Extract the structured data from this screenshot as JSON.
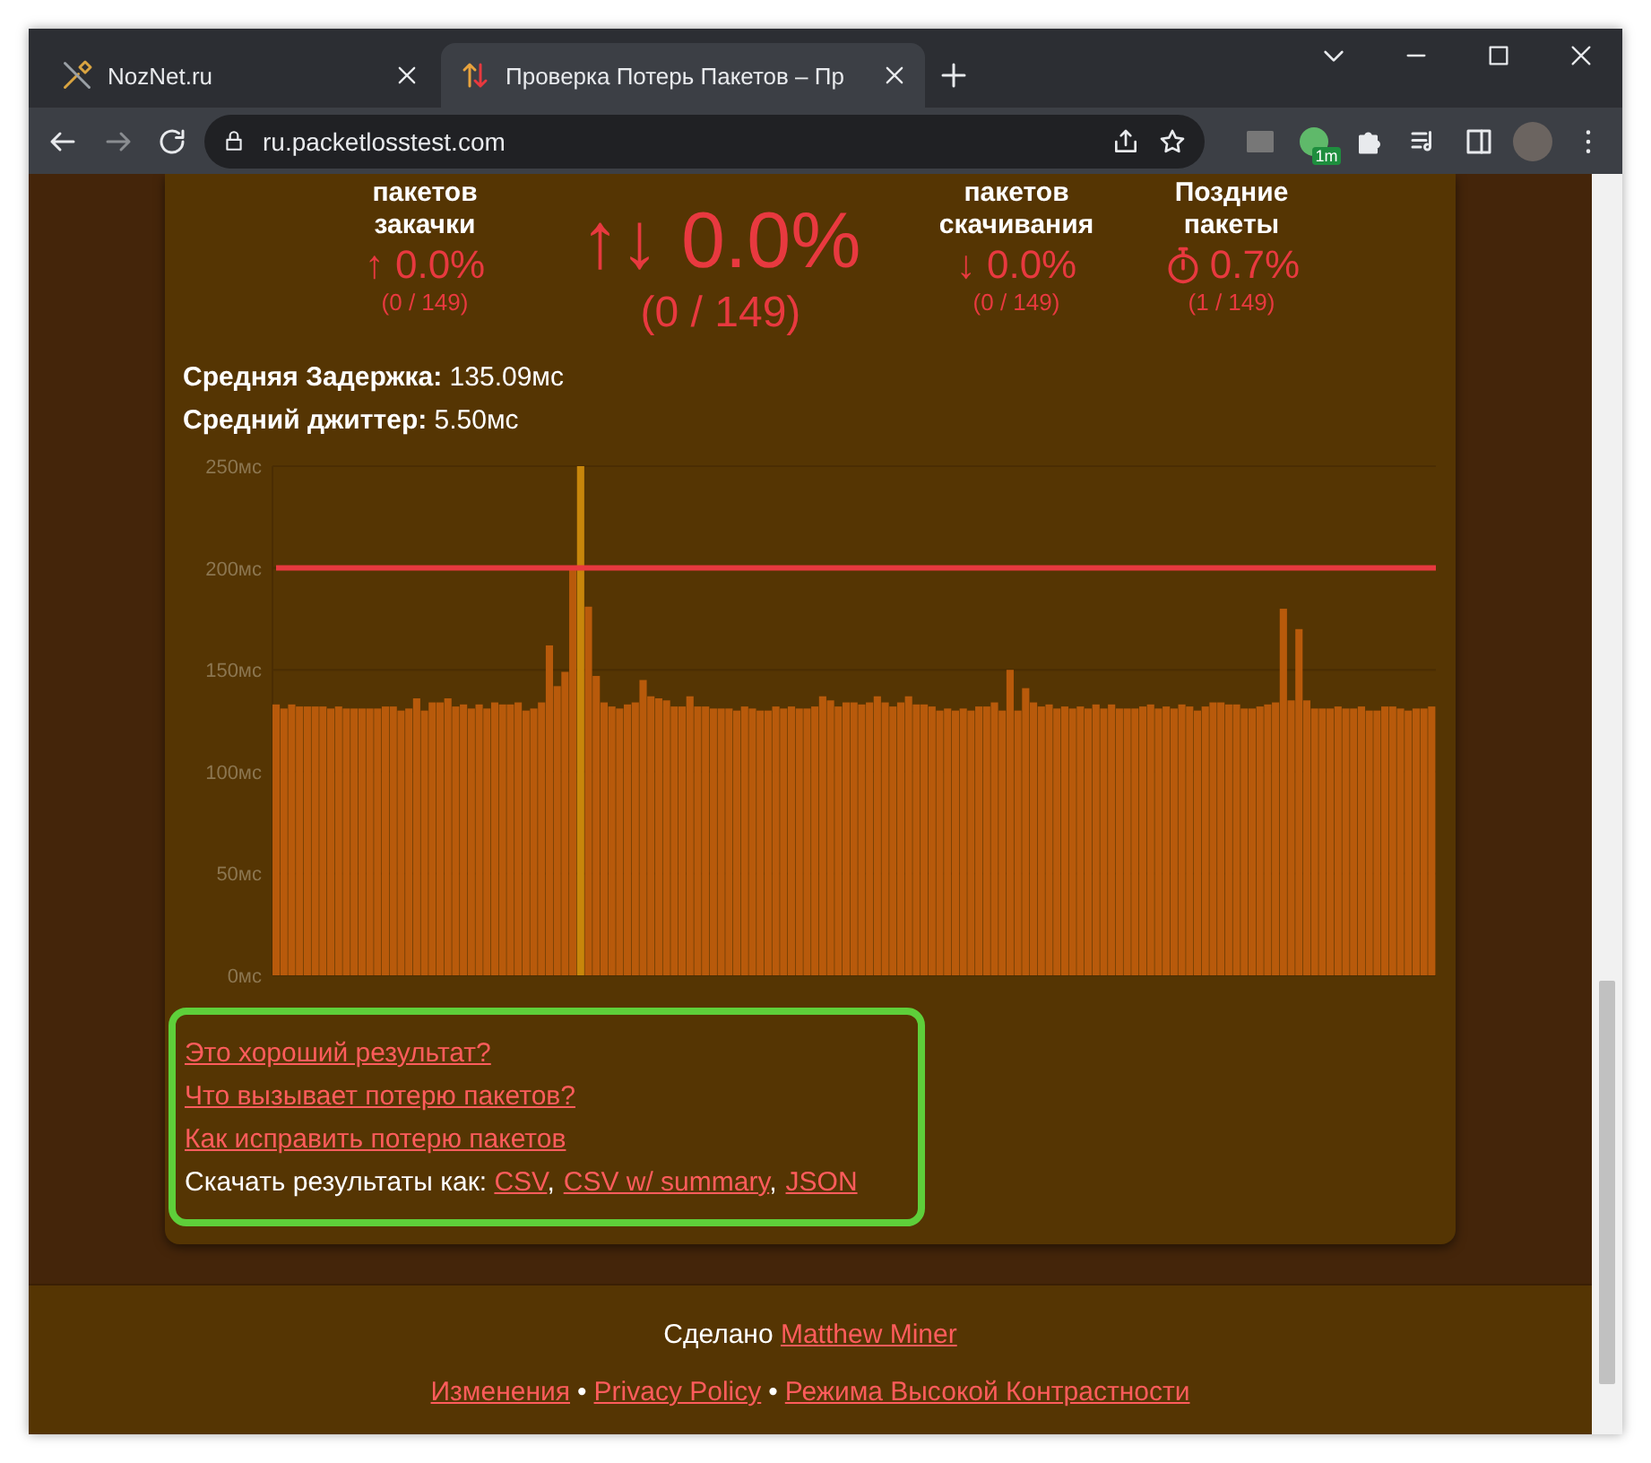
{
  "browser": {
    "tabs": [
      {
        "title": "NozNet.ru",
        "selected": false
      },
      {
        "title": "Проверка Потерь Пакетов – Пр",
        "selected": true
      }
    ],
    "url": "ru.packetlosstest.com",
    "extension_badge": "1m"
  },
  "stats": [
    {
      "kind": "side",
      "label": [
        "пакетов",
        "закачки"
      ],
      "value": "↑ 0.0%",
      "count": "(0 / 149)"
    },
    {
      "kind": "main",
      "value": "↑↓ 0.0%",
      "count": "(0 / 149)"
    },
    {
      "kind": "side",
      "label": [
        "пакетов",
        "скачивания"
      ],
      "value": "↓ 0.0%",
      "count": "(0 / 149)"
    },
    {
      "kind": "timer",
      "label": [
        "Поздние",
        "пакеты"
      ],
      "value": "0.7%",
      "count": "(1 / 149)"
    }
  ],
  "latency": [
    "**Средняя Задержка:** 135.09мс",
    "**Средний джиттер:** 5.50мс"
  ],
  "chart_data": {
    "type": "bar",
    "ylim": [
      0,
      250
    ],
    "yticks": [
      {
        "value": 0,
        "label": "0мс"
      },
      {
        "value": 50,
        "label": "50мс"
      },
      {
        "value": 100,
        "label": "100мс"
      },
      {
        "value": 150,
        "label": "150мс"
      },
      {
        "value": 200,
        "label": "200мс"
      },
      {
        "value": 250,
        "label": "250мс"
      }
    ],
    "values": [
      133,
      131,
      133,
      132,
      132,
      132,
      132,
      131,
      132,
      131,
      131,
      131,
      131,
      131,
      132,
      132,
      130,
      131,
      136,
      130,
      134,
      134,
      136,
      132,
      133,
      131,
      133,
      131,
      134,
      133,
      133,
      134,
      130,
      131,
      134,
      162,
      142,
      149,
      200,
      250,
      181,
      147,
      134,
      132,
      131,
      133,
      134,
      145,
      137,
      136,
      135,
      132,
      132,
      137,
      132,
      132,
      131,
      131,
      131,
      130,
      132,
      131,
      130,
      130,
      132,
      131,
      132,
      131,
      131,
      132,
      137,
      135,
      132,
      134,
      134,
      133,
      134,
      137,
      134,
      132,
      134,
      137,
      133,
      133,
      132,
      130,
      131,
      130,
      131,
      130,
      132,
      132,
      134,
      130,
      150,
      130,
      141,
      134,
      132,
      133,
      131,
      132,
      131,
      132,
      131,
      133,
      131,
      133,
      131,
      131,
      131,
      132,
      133,
      131,
      132,
      131,
      133,
      132,
      130,
      132,
      134,
      134,
      133,
      133,
      131,
      131,
      132,
      133,
      134,
      180,
      135,
      170,
      135,
      131,
      131,
      131,
      132,
      131,
      131,
      132,
      130,
      130,
      132,
      132,
      131,
      130,
      131,
      131,
      132
    ],
    "grid": true,
    "ref_lines": [
      {
        "axis": "y",
        "value": 200
      }
    ]
  },
  "links": [
    "Это хороший результат?",
    "Что вызывает потерю пакетов?",
    "Как исправить потерю пакетов"
  ],
  "download": {
    "label": "Скачать результаты как:",
    "formats": [
      {
        "label": "CSV",
        "after": ","
      },
      {
        "label": "CSV w/ summary",
        "after": ","
      },
      {
        "label": "JSON"
      }
    ]
  },
  "footer": {
    "credit_text": "Сделано",
    "credit_link": "Matthew Miner",
    "links": [
      {
        "label": "Изменения",
        "after": "•"
      },
      {
        "label": "Privacy Policy",
        "after": "•"
      },
      {
        "label": "Режима Высокой Контрастности"
      }
    ]
  }
}
